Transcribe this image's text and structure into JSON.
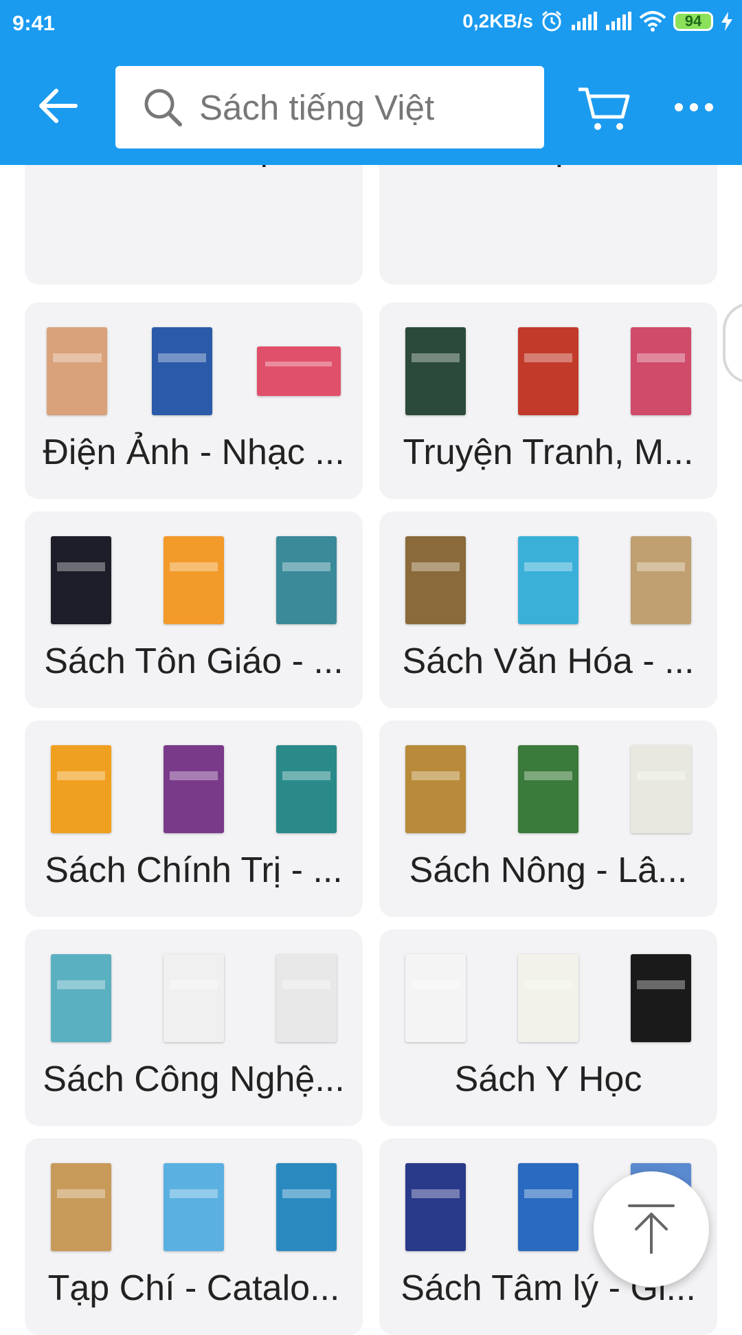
{
  "status_bar": {
    "time": "9:41",
    "network_speed": "0,2KB/s",
    "battery": "94"
  },
  "header": {
    "search_placeholder": "Sách tiếng Việt",
    "accent_color": "#1a9bf0"
  },
  "categories": [
    {
      "label": "Sách Khoa Học -...",
      "covers": [
        "#1d2a55",
        "#2a2a2a",
        "#4a4a4a"
      ]
    },
    {
      "label": "Sách Lịch sử",
      "covers": [
        "#dcdcdc",
        "#151515",
        "#c8402a"
      ]
    },
    {
      "label": "Điện Ảnh - Nhạc ...",
      "covers": [
        "#d9a27a",
        "#2a5aa8",
        "#e0506a"
      ]
    },
    {
      "label": "Truyện Tranh, M...",
      "covers": [
        "#2b4a3a",
        "#c23a2a",
        "#d04a6a"
      ]
    },
    {
      "label": "Sách Tôn Giáo - ...",
      "covers": [
        "#1e1e2a",
        "#f29a2a",
        "#3a8a9a"
      ]
    },
    {
      "label": "Sách Văn Hóa - ...",
      "covers": [
        "#8a6a3a",
        "#3ab0d8",
        "#c0a070"
      ]
    },
    {
      "label": "Sách Chính Trị - ...",
      "covers": [
        "#f0a020",
        "#7a3a8a",
        "#2a8a8a"
      ]
    },
    {
      "label": "Sách Nông - Lâ...",
      "covers": [
        "#b88a3a",
        "#3a7a3a",
        "#e8e8e0"
      ]
    },
    {
      "label": "Sách Công Nghệ...",
      "covers": [
        "#5ab0c0",
        "#f0f0f0",
        "#e8e8e8"
      ]
    },
    {
      "label": "Sách Y Học",
      "covers": [
        "#f4f4f4",
        "#f2f2ea",
        "#1a1a1a"
      ]
    },
    {
      "label": "Tạp Chí - Catalo...",
      "covers": [
        "#c89a5a",
        "#5ab0e0",
        "#2a8ac0"
      ]
    },
    {
      "label": "Sách Tâm lý - Gi...",
      "covers": [
        "#2a3a8a",
        "#2a6ac0",
        "#5a8ad0"
      ]
    }
  ]
}
